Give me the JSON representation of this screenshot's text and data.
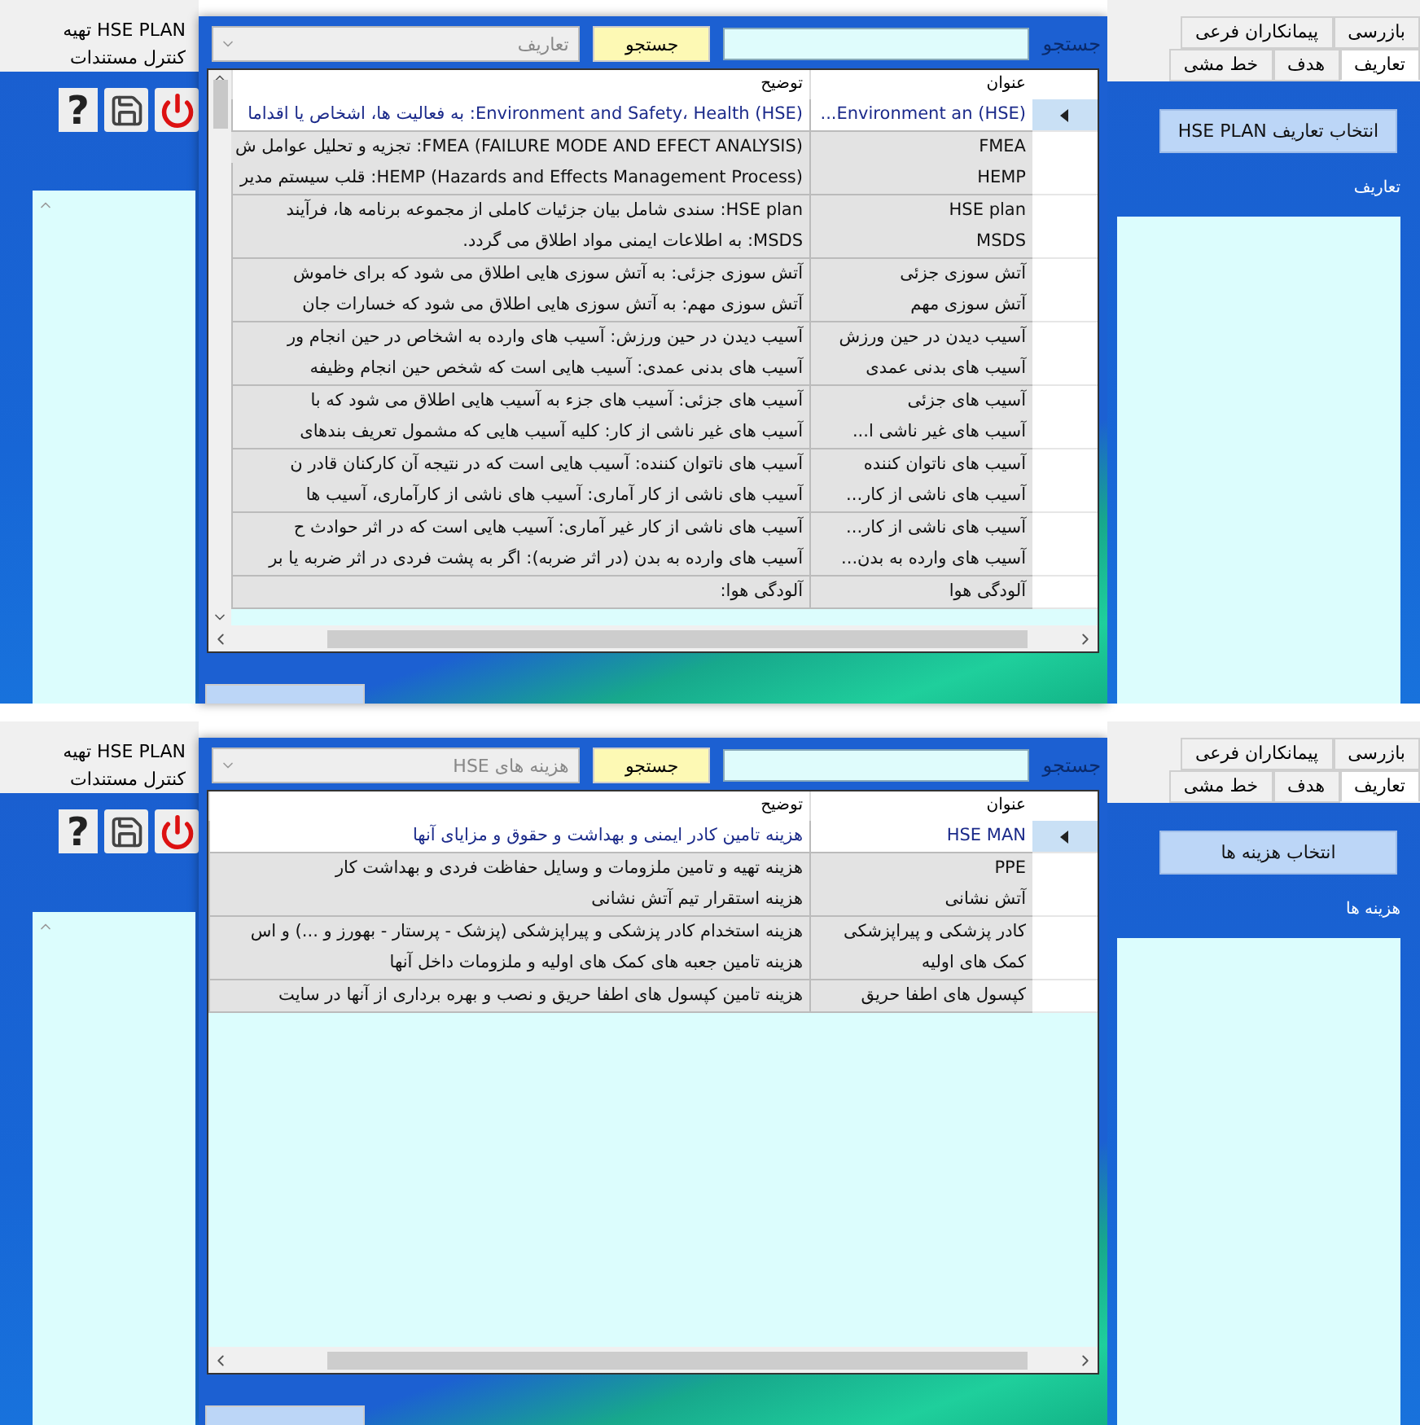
{
  "panels": [
    {
      "left_tabs": [
        {
          "label": "تهیه HSE PLAN"
        },
        {
          "label": "کنترل مستندات"
        }
      ],
      "right_tabs": [
        [
          {
            "label": "بازرسی",
            "selected": false
          },
          {
            "label": "پیمانکاران فرعی",
            "selected": false
          }
        ],
        [
          {
            "label": "تعاریف",
            "selected": true
          },
          {
            "label": "هدف",
            "selected": false
          },
          {
            "label": "خط مشی",
            "selected": false
          }
        ]
      ],
      "help_key": "?",
      "side_button": "انتخاب تعاریف HSE PLAN",
      "side_label": "تعاریف",
      "dialog": {
        "search_label": "جستجو",
        "search_button": "جستجو",
        "category": "تعاریف",
        "columns": [
          "عنوان",
          "توضیح"
        ],
        "rows": [
          {
            "title": "(HSE) Environment an...",
            "description": "(HSE) Environment and Safety، Health: به فعالیت ها، اشخاص یا اقداما",
            "selected": true
          },
          {
            "title": "FMEA",
            "description": "FMEA (FAILURE MODE AND EFECT ANALYSIS): تجزیه و تحلیل عوامل ش",
            "selected": false
          },
          {
            "title": "HEMP",
            "description": "HEMP (Hazards and Effects Management Process): قلب سیستم مدیر",
            "selected": false
          },
          {
            "title": "HSE plan",
            "description": "HSE plan: سندی شامل بیان جزئیات کاملی از مجموعه برنامه ها، فرآیند",
            "selected": false
          },
          {
            "title": "MSDS",
            "description": "MSDS: به اطلاعات ایمنی مواد اطلاق می گردد.",
            "selected": false
          },
          {
            "title": "آتش سوزی جزئی",
            "description": "آتش سوزی جزئی: به آتش سوزی هایی اطلاق می شود که برای خاموش",
            "selected": false
          },
          {
            "title": "آتش سوزی مهم",
            "description": "آتش سوزی مهم: به آتش سوزی هایی اطلاق می شود که خسارات جان",
            "selected": false
          },
          {
            "title": "آسیب دیدن در حین ورزش",
            "description": "آسیب دیدن در حین ورزش: آسیب های وارده به اشخاص در حین انجام ور",
            "selected": false
          },
          {
            "title": "آسیب های بدنی عمدی",
            "description": "آسیب های بدنی عمدی: آسیب هایی است که شخص حین انجام وظیفه",
            "selected": false
          },
          {
            "title": "آسیب های جزئی",
            "description": "آسیب های جزئی: آسیب های جزء به آسیب هایی اطلاق می شود که با",
            "selected": false
          },
          {
            "title": "آسیب های غیر ناشی ا...",
            "description": "آسیب های غیر ناشی از کار: کلیه آسیب هایی که مشمول تعریف بندهای",
            "selected": false
          },
          {
            "title": "آسیب های ناتوان کننده",
            "description": "آسیب های ناتوان کننده: آسیب هایی است که در نتیجه آن کارکنان قادر ن",
            "selected": false
          },
          {
            "title": "آسیب های ناشی از کار...",
            "description": "آسیب های ناشی از کار آماری: آسیب های ناشی از کارآماری، آسیب ها",
            "selected": false
          },
          {
            "title": "آسیب های ناشی از کار...",
            "description": "آسیب های ناشی از کار غیر آماری: آسیب هایی است که در اثر حوادث ح",
            "selected": false
          },
          {
            "title": "آسیب های وارده به بدن...",
            "description": "آسیب های وارده به بدن (در اثر ضربه): اگر به پشت فردی در اثر ضربه یا بر",
            "selected": false
          },
          {
            "title": "آلودگی هوا",
            "description": "آلودگی هوا:",
            "selected": false
          }
        ]
      }
    },
    {
      "left_tabs": [
        {
          "label": "تهیه HSE PLAN"
        },
        {
          "label": "کنترل مستندات"
        }
      ],
      "right_tabs": [
        [
          {
            "label": "بازرسی",
            "selected": false
          },
          {
            "label": "پیمانکاران فرعی",
            "selected": false
          }
        ],
        [
          {
            "label": "تعاریف",
            "selected": true
          },
          {
            "label": "هدف",
            "selected": false
          },
          {
            "label": "خط مشی",
            "selected": false
          }
        ]
      ],
      "help_key": "?",
      "side_button": "انتخاب هزینه ها",
      "side_label": "هزینه ها",
      "dialog": {
        "search_label": "جستجو",
        "search_button": "جستجو",
        "category": "هزینه های HSE",
        "columns": [
          "عنوان",
          "توضیح"
        ],
        "rows": [
          {
            "title": "HSE MAN",
            "description": "هزینه تامین کادر ایمنی و بهداشت و حقوق و مزایای آنها",
            "selected": true
          },
          {
            "title": "PPE",
            "description": "هزینه تهیه و تامین ملزومات و وسایل حفاظت فردی و بهداشت کار",
            "selected": false
          },
          {
            "title": "آتش نشانی",
            "description": "هزینه استقرار تیم آتش نشانی",
            "selected": false
          },
          {
            "title": "کادر پزشکی و پیراپزشکی",
            "description": "هزینه استخدام کادر پزشکی و پیراپزشکی (پزشک - پرستار - بهورز و ...) و اس",
            "selected": false
          },
          {
            "title": "کمک های اولیه",
            "description": "هزینه تامین جعبه های کمک های اولیه و ملزومات داخل آنها",
            "selected": false
          },
          {
            "title": "کپسول های اطفا حریق",
            "description": "هزینه تامین کپسول های اطفا حریق و نصب و بهره برداری از آنها در سایت",
            "selected": false
          }
        ]
      }
    }
  ]
}
